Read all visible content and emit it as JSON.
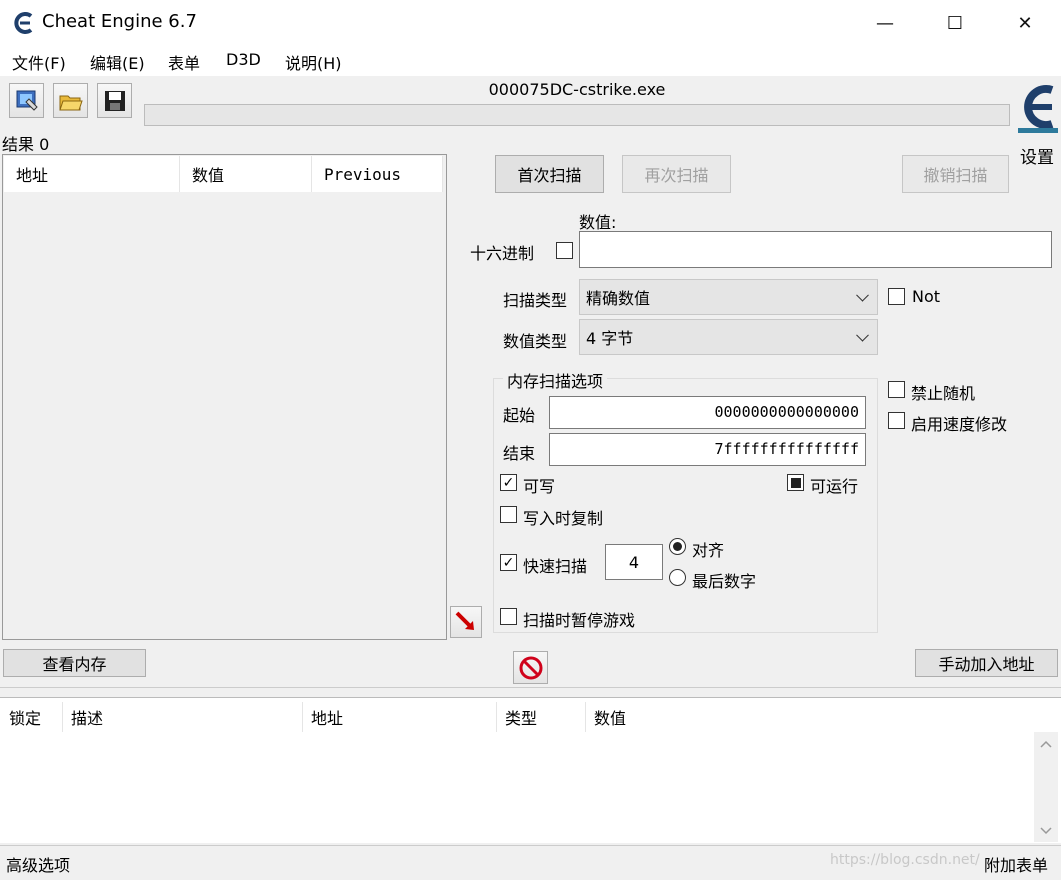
{
  "window": {
    "title": "Cheat Engine 6.7",
    "minimize_icon": "—",
    "maximize_icon": "☐",
    "close_icon": "✕"
  },
  "menu": [
    "文件(F)",
    "编辑(E)",
    "表单",
    "D3D",
    "说明(H)"
  ],
  "process_name": "000075DC-cstrike.exe",
  "settings_label": "设置",
  "results_label": "结果 0",
  "results_columns": [
    "地址",
    "数值",
    "Previous"
  ],
  "scan_buttons": {
    "first": "首次扫描",
    "next": "再次扫描",
    "undo": "撤销扫描"
  },
  "value": {
    "label": "数值:",
    "hex_label": "十六进制",
    "input": ""
  },
  "scan_type": {
    "label": "扫描类型",
    "selected": "精确数值"
  },
  "value_type": {
    "label": "数值类型",
    "selected": "4 字节"
  },
  "not_label": "Not",
  "memory_options": {
    "group_label": "内存扫描选项",
    "start_label": "起始",
    "start_value": "0000000000000000",
    "stop_label": "结束",
    "stop_value": "7fffffffffffffff",
    "writable": "可写",
    "executable": "可运行",
    "copy_on_write": "写入时复制",
    "fast_scan": "快速扫描",
    "fast_scan_value": "4",
    "align": "对齐",
    "last_digits": "最后数字",
    "pause_game": "扫描时暂停游戏"
  },
  "right_options": {
    "no_random": "禁止随机",
    "speedhack": "启用速度修改"
  },
  "view_memory": "查看内存",
  "add_address": "手动加入地址",
  "address_columns": [
    "锁定",
    "描述",
    "地址",
    "类型",
    "数值"
  ],
  "status": {
    "advanced": "高级选项",
    "table_extras": "附加表单",
    "watermark": "https://blog.csdn.net/"
  },
  "colors": {
    "accent": "#1f4e8c",
    "stop_red": "#d0021b"
  }
}
